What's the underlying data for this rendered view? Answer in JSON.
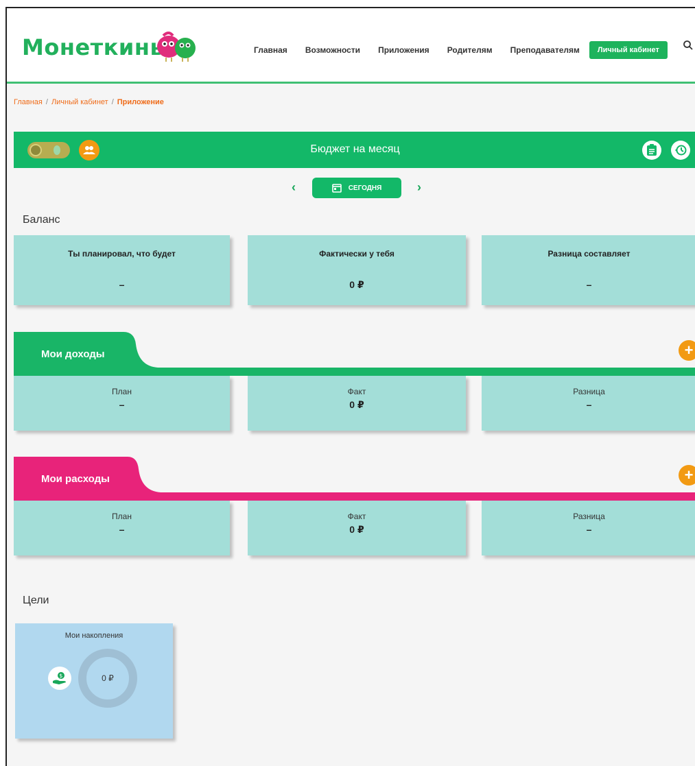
{
  "header": {
    "logo": "Монеткины",
    "nav": [
      "Главная",
      "Возможности",
      "Приложения",
      "Родителям",
      "Преподавателям"
    ],
    "cabinet_button": "Личный кабинет"
  },
  "breadcrumb": {
    "home": "Главная",
    "cabinet": "Личный кабинет",
    "current": "Приложение",
    "separator": "/"
  },
  "budget": {
    "title": "Бюджет на месяц",
    "today_button": "СЕГОДНЯ",
    "prev_arrow": "‹",
    "next_arrow": "›"
  },
  "balance": {
    "label": "Баланс",
    "cards": [
      {
        "title": "Ты планировал, что будет",
        "value": "–"
      },
      {
        "title": "Фактически у тебя",
        "value": "0 ₽"
      },
      {
        "title": "Разница составляет",
        "value": "–"
      }
    ]
  },
  "income": {
    "title": "Мои доходы",
    "add": "+",
    "cards": [
      {
        "title": "План",
        "value": "–"
      },
      {
        "title": "Факт",
        "value": "0 ₽"
      },
      {
        "title": "Разница",
        "value": "–"
      }
    ]
  },
  "expenses": {
    "title": "Мои расходы",
    "add": "+",
    "cards": [
      {
        "title": "План",
        "value": "–"
      },
      {
        "title": "Факт",
        "value": "0 ₽"
      },
      {
        "title": "Разница",
        "value": "–"
      }
    ]
  },
  "goals": {
    "label": "Цели",
    "card_title": "Мои накопления",
    "amount": "0 ₽"
  },
  "colors": {
    "brand_green": "#13b868",
    "income_green": "#19b567",
    "expense_pink": "#e8237a",
    "accent_orange": "#f29a13",
    "card_teal": "#a3ded8",
    "goal_blue": "#b1d8ef"
  }
}
